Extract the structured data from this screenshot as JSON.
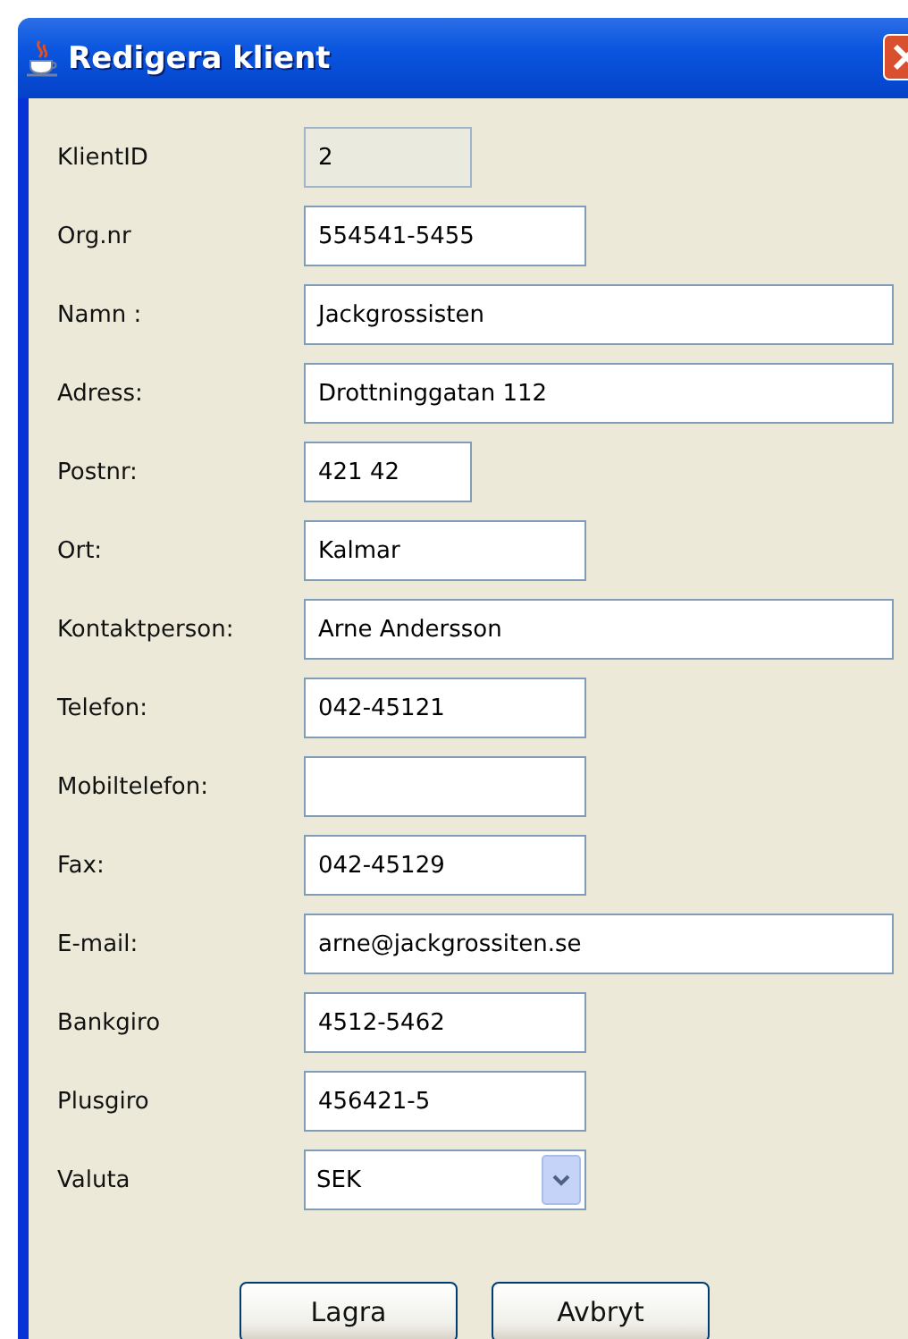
{
  "window": {
    "title": "Redigera klient"
  },
  "fields": [
    {
      "label": "KlientID",
      "value": "2",
      "kind": "text",
      "disabled": true
    },
    {
      "label": "Org.nr",
      "value": "554541-5455",
      "kind": "text",
      "disabled": false
    },
    {
      "label": "Namn :",
      "value": "Jackgrossisten",
      "kind": "text",
      "disabled": false
    },
    {
      "label": "Adress:",
      "value": "Drottninggatan 112",
      "kind": "text",
      "disabled": false
    },
    {
      "label": "Postnr:",
      "value": "421 42",
      "kind": "text",
      "disabled": false
    },
    {
      "label": "Ort:",
      "value": "Kalmar",
      "kind": "text",
      "disabled": false
    },
    {
      "label": "Kontaktperson:",
      "value": "Arne Andersson",
      "kind": "text",
      "disabled": false
    },
    {
      "label": "Telefon:",
      "value": "042-45121",
      "kind": "text",
      "disabled": false
    },
    {
      "label": "Mobiltelefon:",
      "kind": "text",
      "disabled": false
    },
    {
      "label": "Fax:",
      "value": "042-45129",
      "kind": "text",
      "disabled": false
    },
    {
      "label": "E-mail:",
      "value": "arne@jackgrossiten.se",
      "kind": "text",
      "disabled": false
    },
    {
      "label": "Bankgiro",
      "value": "4512-5462",
      "kind": "text",
      "disabled": false
    },
    {
      "label": "Plusgiro",
      "value": "456421-5",
      "kind": "text",
      "disabled": false
    },
    {
      "label": "Valuta",
      "value": "SEK",
      "kind": "select",
      "disabled": false
    }
  ],
  "buttons": [
    "Lagra",
    "Avbryt"
  ]
}
